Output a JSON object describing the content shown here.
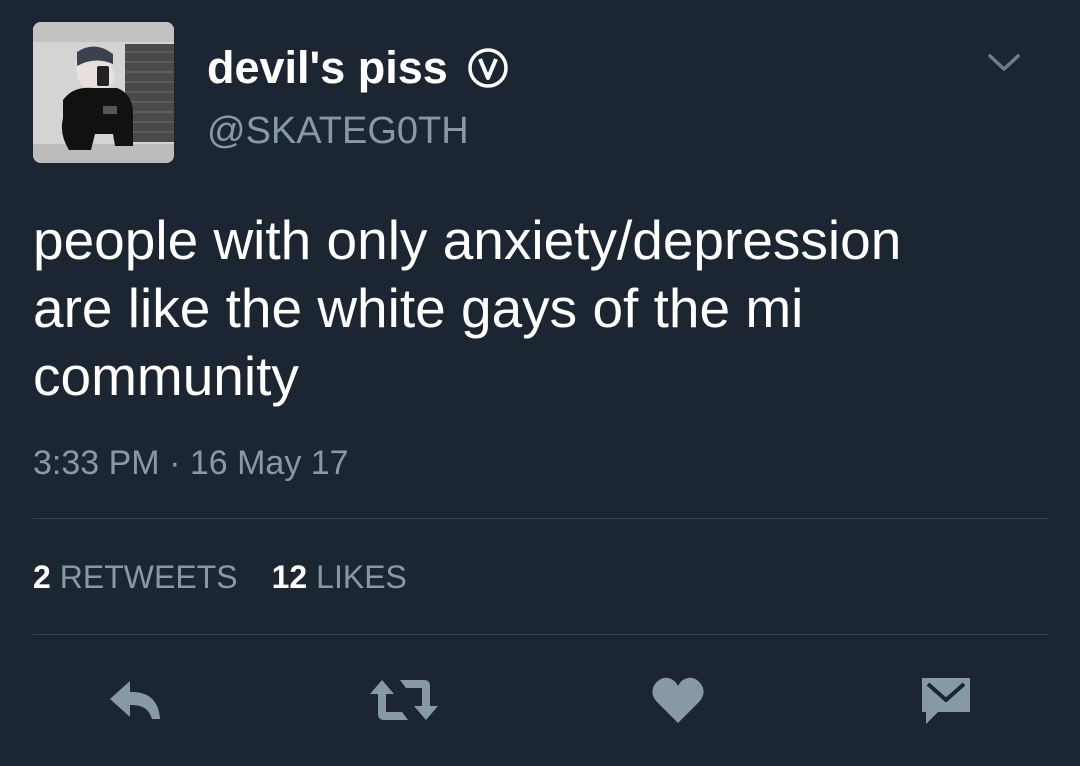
{
  "user": {
    "display_name": "devil's piss",
    "handle": "@SKATEG0TH",
    "avatar_icon": "profile-photo",
    "badge_icon": "verified-v-icon"
  },
  "tweet": {
    "text_lines": [
      "people with only anxiety/depression",
      "are like the white gays of the mi",
      "community"
    ],
    "timestamp": "3:33 PM · 16 May 17"
  },
  "stats": {
    "retweets_count": "2",
    "retweets_label": "RETWEETS",
    "likes_count": "12",
    "likes_label": "LIKES"
  },
  "actions": [
    {
      "name": "reply",
      "icon": "reply-icon"
    },
    {
      "name": "retweet",
      "icon": "retweet-icon"
    },
    {
      "name": "like",
      "icon": "heart-icon"
    },
    {
      "name": "direct-message",
      "icon": "envelope-icon"
    }
  ],
  "colors": {
    "background": "#1b2632",
    "primary_text": "#ffffff",
    "secondary_text": "#8899a6",
    "icon": "#8899a6",
    "divider": "#38444d"
  }
}
